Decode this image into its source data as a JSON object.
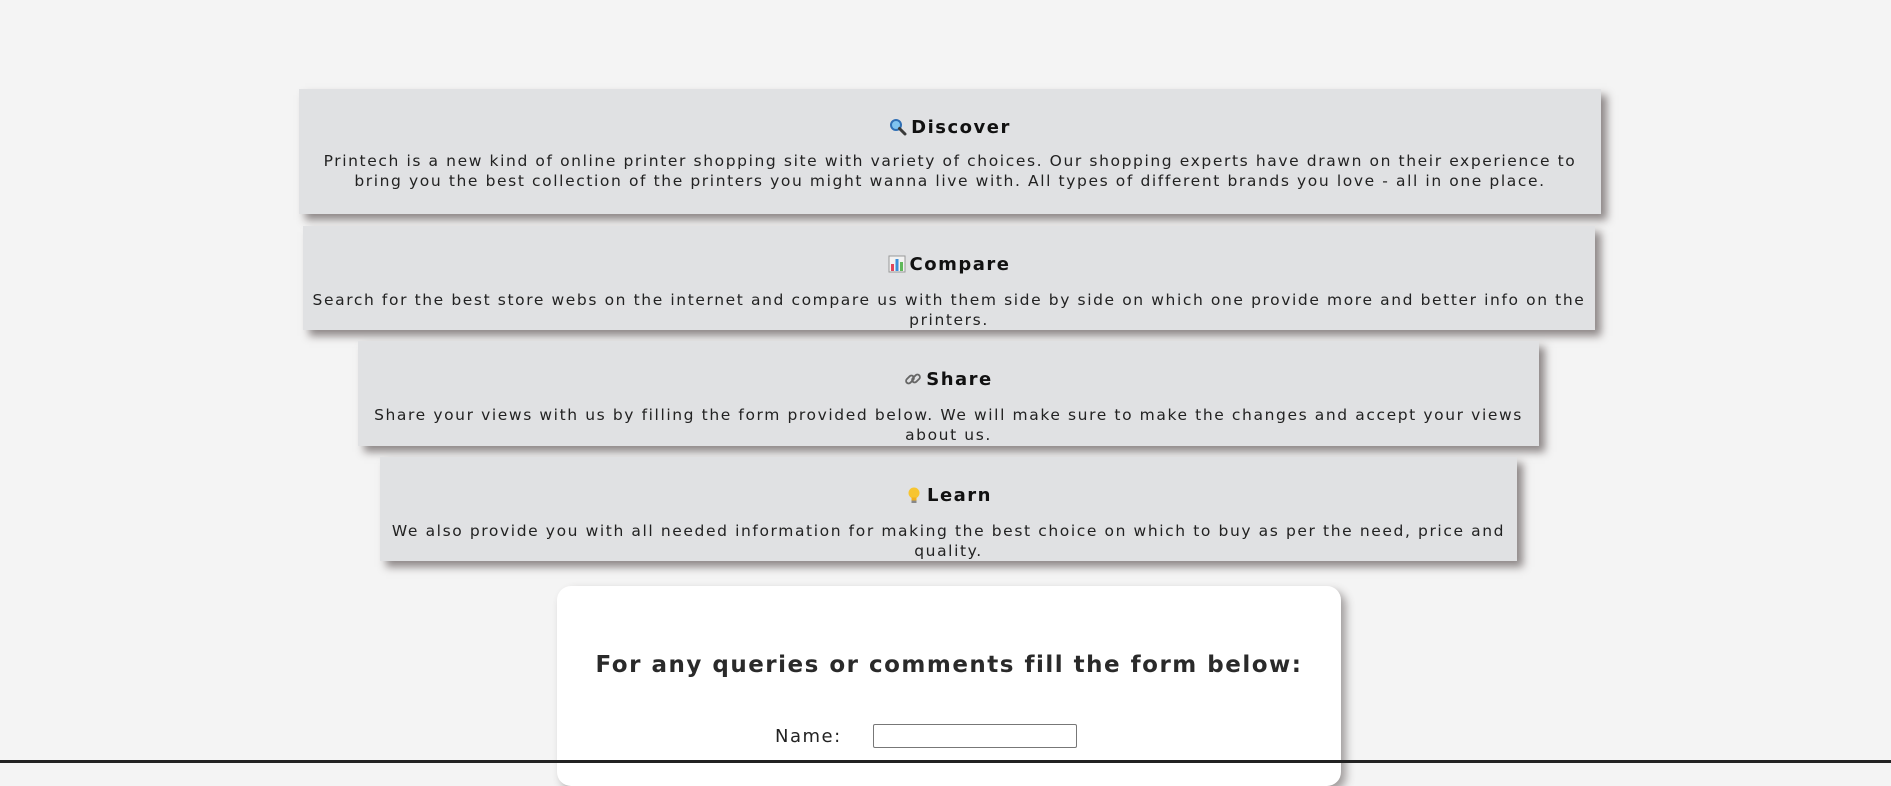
{
  "cards": [
    {
      "icon": "magnifier-icon",
      "title": "Discover",
      "text": "Printech is a new kind of online printer shopping site with variety of choices. Our shopping experts have drawn on their experience to bring you the best collection of the printers you might wanna live with. All types of different brands you love - all in one place."
    },
    {
      "icon": "bar-chart-icon",
      "title": "Compare",
      "text": "Search for the best store webs on the internet and compare us with them side by side on which one provide more and better info on the printers."
    },
    {
      "icon": "link-icon",
      "title": "Share",
      "text": "Share your views with us by filling the form provided below. We will make sure to make the changes and accept your views about us."
    },
    {
      "icon": "lightbulb-icon",
      "title": "Learn",
      "text": "We also provide you with all needed information for making the best choice on which to buy as per the need, price and quality."
    }
  ],
  "form": {
    "heading": "For any queries or comments fill the form below:",
    "name_label": "Name:",
    "name_value": ""
  },
  "colors": {
    "page_background": "#f4f4f4",
    "card_background": "#e0e1e3",
    "form_background": "#ffffff"
  }
}
